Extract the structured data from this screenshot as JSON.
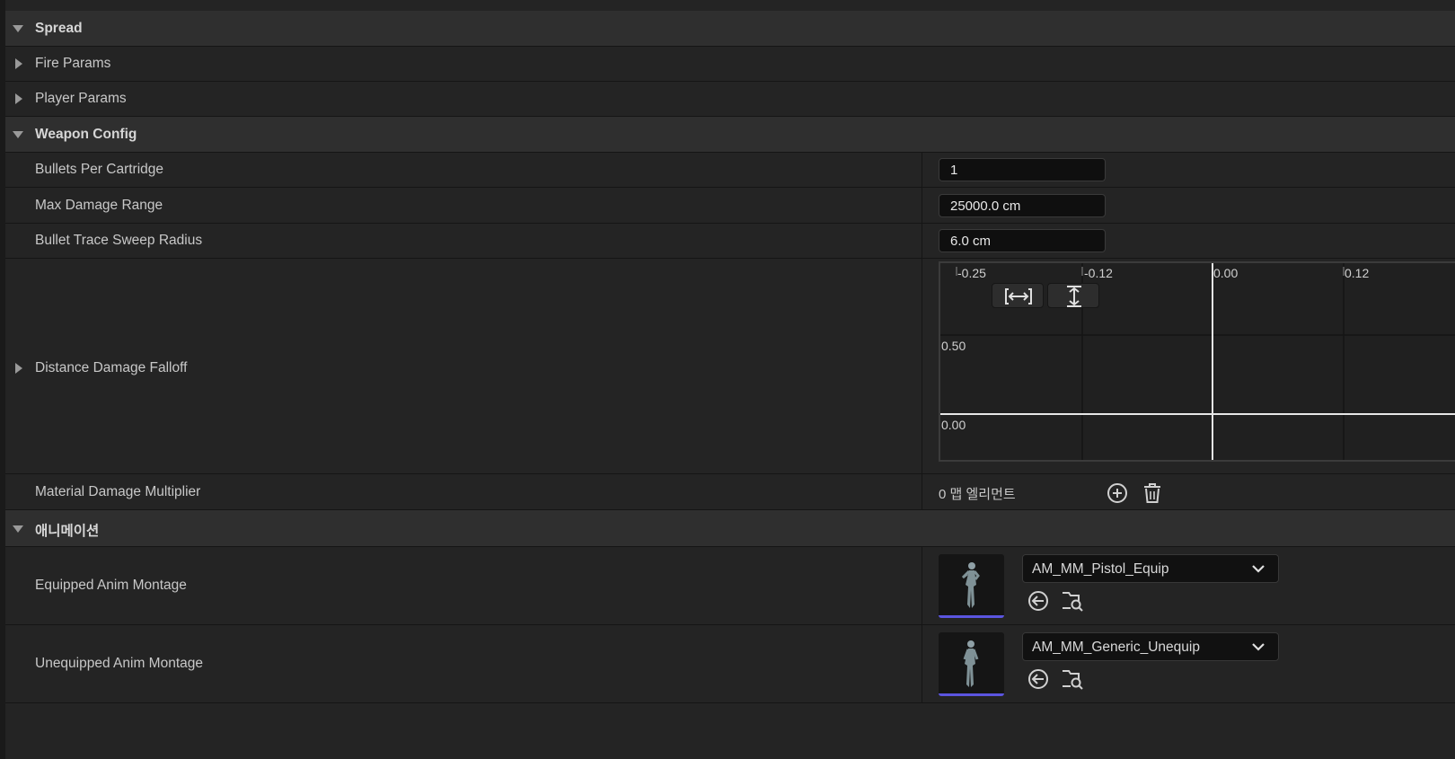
{
  "categories": {
    "spread": "Spread",
    "weapon_config": "Weapon Config",
    "animation": "애니메이션"
  },
  "rows": {
    "fire_params": "Fire Params",
    "player_params": "Player Params",
    "bullets_per_cartridge": {
      "label": "Bullets Per Cartridge",
      "value": "1"
    },
    "max_damage_range": {
      "label": "Max Damage Range",
      "value": "25000.0 cm"
    },
    "bullet_trace_sweep_radius": {
      "label": "Bullet Trace Sweep Radius",
      "value": "6.0 cm"
    },
    "distance_damage_falloff": {
      "label": "Distance Damage Falloff"
    },
    "material_damage_multiplier": {
      "label": "Material Damage Multiplier",
      "value": "0 맵 엘리먼트"
    },
    "equipped_anim_montage": {
      "label": "Equipped Anim Montage",
      "asset": "AM_MM_Pistol_Equip"
    },
    "unequipped_anim_montage": {
      "label": "Unequipped Anim Montage",
      "asset": "AM_MM_Generic_Unequip"
    }
  },
  "curve_graph": {
    "x_ticks": [
      "-0.25",
      "-0.12",
      "0.00",
      "0.12"
    ],
    "y_ticks": [
      "0.50",
      "0.00"
    ]
  },
  "icons": {
    "expanded": "triangle-down-icon",
    "collapsed": "triangle-right-icon",
    "fit_horizontal": "fit-horizontal-icon",
    "fit_vertical": "fit-vertical-icon",
    "add": "plus-circle-icon",
    "delete": "trash-icon",
    "use_selected": "arrow-left-circle-icon",
    "browse": "folder-search-icon",
    "dropdown": "chevron-down-icon"
  },
  "colors": {
    "thumbnail_bar": "#5b55e0",
    "category_bg": "#2f2f2f",
    "row_bg": "#242424"
  }
}
